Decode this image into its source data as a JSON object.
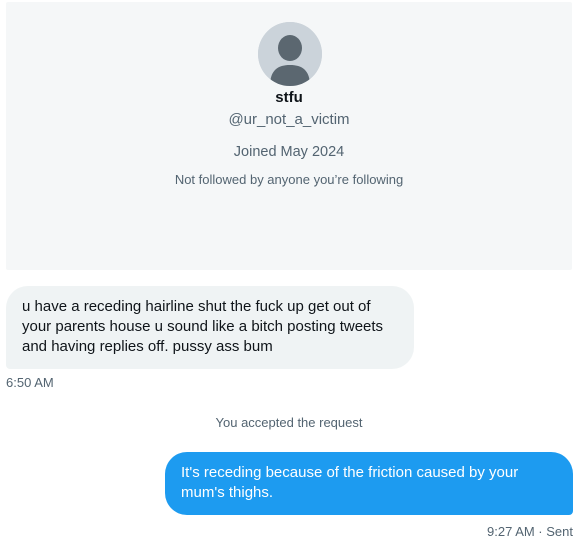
{
  "profile": {
    "display_name": "stfu",
    "handle": "@ur_not_a_victim",
    "joined": "Joined May 2024",
    "follow_status": "Not followed by anyone you’re following",
    "avatar_icon": "default-avatar-icon"
  },
  "messages": [
    {
      "direction": "incoming",
      "lines": [
        "u have a receding hairline shut the fuck up get out of",
        "your parents house u sound like a bitch posting tweets",
        "and having replies off. pussy ass bum"
      ],
      "time": "6:50 AM"
    },
    {
      "direction": "outgoing",
      "lines": [
        "It's receding because of the friction caused by your",
        "mum's thighs."
      ],
      "meta": "9:27 AM · Sent"
    }
  ],
  "system_message": "You accepted the request",
  "colors": {
    "accent": "#1d9bf0",
    "incoming_bubble": "#eff3f4",
    "card_background": "#f5f7f8",
    "secondary_text": "#536471"
  }
}
